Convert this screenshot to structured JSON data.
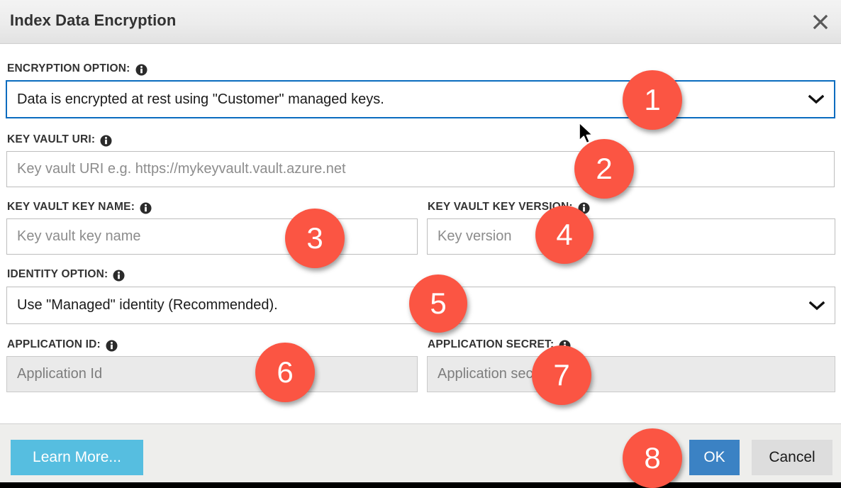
{
  "window": {
    "title": "Index Data Encryption",
    "close_icon": "close-icon"
  },
  "form": {
    "encryption_option": {
      "label": "ENCRYPTION OPTION:",
      "info_icon": "info-icon",
      "value": "Data is encrypted at rest using \"Customer\" managed keys.",
      "chevron_icon": "chevron-down-icon",
      "focused": true
    },
    "key_vault_uri": {
      "label": "KEY VAULT URI:",
      "info_icon": "info-icon",
      "value": "",
      "placeholder": "Key vault URI e.g. https://mykeyvault.vault.azure.net"
    },
    "key_vault_key_name": {
      "label": "KEY VAULT KEY NAME:",
      "info_icon": "info-icon",
      "value": "",
      "placeholder": "Key vault key name"
    },
    "key_vault_key_version": {
      "label": "KEY VAULT KEY VERSION:",
      "info_icon": "info-icon",
      "value": "",
      "placeholder": "Key version"
    },
    "identity_option": {
      "label": "IDENTITY OPTION:",
      "info_icon": "info-icon",
      "value": "Use \"Managed\" identity (Recommended).",
      "chevron_icon": "chevron-down-icon"
    },
    "application_id": {
      "label": "APPLICATION ID:",
      "info_icon": "info-icon",
      "value": "",
      "placeholder": "Application Id",
      "disabled": true
    },
    "application_secret": {
      "label": "APPLICATION SECRET:",
      "info_icon": "info-icon",
      "value": "",
      "placeholder": "Application secret",
      "disabled": true
    }
  },
  "footer": {
    "learn_more_label": "Learn More...",
    "ok_label": "OK",
    "cancel_label": "Cancel"
  },
  "annotations": {
    "badge_1": "1",
    "badge_2": "2",
    "badge_3": "3",
    "badge_4": "4",
    "badge_5": "5",
    "badge_6": "6",
    "badge_7": "7",
    "badge_8": "8"
  },
  "colors": {
    "badge": "#fb5543",
    "focus_border": "#0a6cbf",
    "primary_button": "#3b82c4",
    "learn_more_button": "#56bee0",
    "header_bg": "#ececec",
    "footer_bg": "#eeeeec",
    "disabled_field_bg": "#eaeaea"
  }
}
